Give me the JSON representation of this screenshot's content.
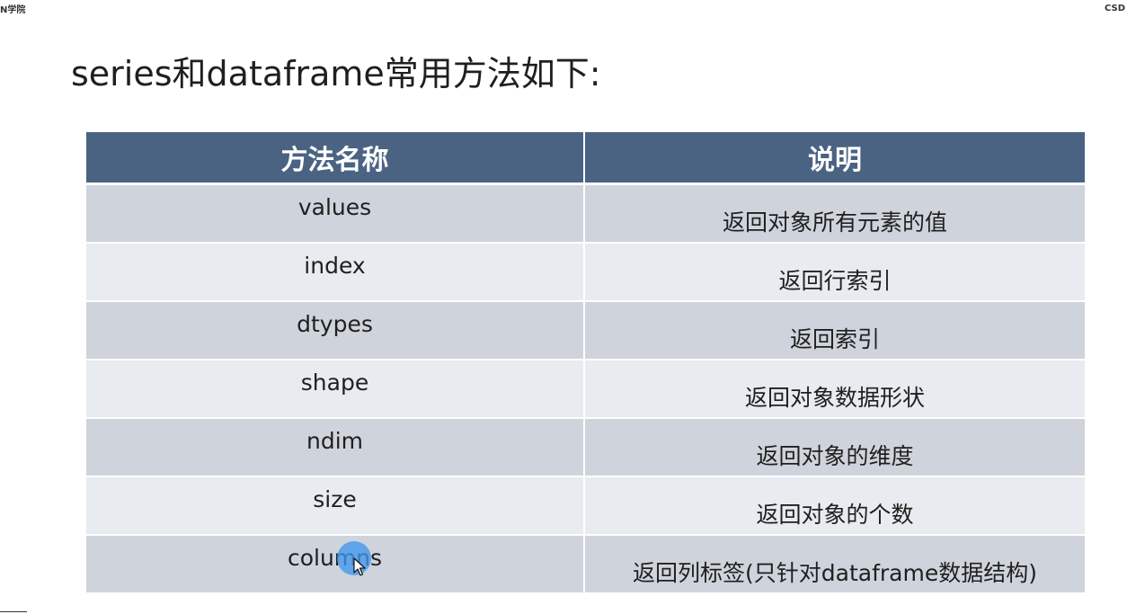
{
  "watermark": {
    "left_text": "N学院",
    "right_text": "CSD"
  },
  "title": "series和dataframe常用方法如下:",
  "table": {
    "headers": [
      "方法名称",
      "说明"
    ],
    "rows": [
      {
        "method": "values",
        "description": "返回对象所有元素的值"
      },
      {
        "method": "index",
        "description": "返回行索引"
      },
      {
        "method": "dtypes",
        "description": "返回索引"
      },
      {
        "method": "shape",
        "description": "返回对象数据形状"
      },
      {
        "method": "ndim",
        "description": "返回对象的维度"
      },
      {
        "method": "size",
        "description": "返回对象的个数"
      },
      {
        "method": "columns",
        "description": "返回列标签(只针对dataframe数据结构)"
      }
    ]
  },
  "colors": {
    "header_bg": "#4a6383",
    "row_dark": "#cfd4dc",
    "row_light": "#e8ebef",
    "cursor_highlight": "#4096ee"
  },
  "icons": {
    "pointer": "mouse-pointer-icon"
  }
}
